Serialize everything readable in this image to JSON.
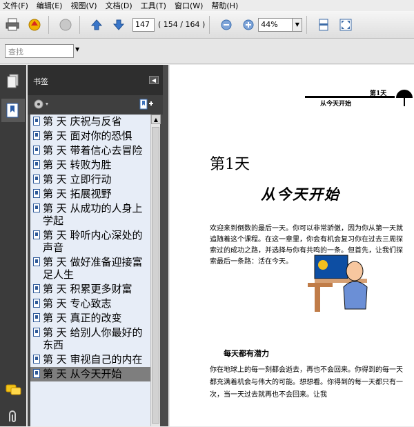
{
  "menu": {
    "items": [
      "文件(F)",
      "编辑(E)",
      "视图(V)",
      "文档(D)",
      "工具(T)",
      "窗口(W)",
      "帮助(H)"
    ]
  },
  "toolbar": {
    "page_value": "147",
    "page_count": "( 154 / 164 )",
    "zoom_value": "44%"
  },
  "find": {
    "placeholder": "查找"
  },
  "bookmarks": {
    "title": "书签",
    "items": [
      "第 天  庆祝与反省",
      "第 天  面对你的恐惧",
      "第 天  带着信心去冒险",
      "第 天  转败为胜",
      "第 天  立即行动",
      "第 天  拓展视野",
      "第 天  从成功的人身上学起",
      "第 天  聆听内心深处的声音",
      "第 天  做好准备迎接富足人生",
      "第 天  积累更多财富",
      "第 天  专心致志",
      "第 天  真正的改变",
      "第 天  给别人你最好的东西",
      "第 天  审视自己的内在",
      "第 天  从今天开始"
    ]
  },
  "page": {
    "header_right": "第1天",
    "header_mid": "从今天开始",
    "chapter_title": "第1天",
    "main_title": "从今天开始",
    "paragraph1": "欢迎来到倒数的最后一天。你可以非常骄傲，因为你从第一天就追随着这个课程。在这一章里，你会有机会复习你在过去三周探索过的成功之路，并选择与你有共鸣的一条。但首先，让我们探索最后一条路：活在今天。",
    "subheading": "每天都有潜力",
    "paragraph2": "你在地球上的每一刻都会逝去，再也不会回来。你得到的每一天都充满着机会与伟大的可能。想想看。你得到的每一天都只有一次，当一天过去就再也不会回来。让我"
  }
}
